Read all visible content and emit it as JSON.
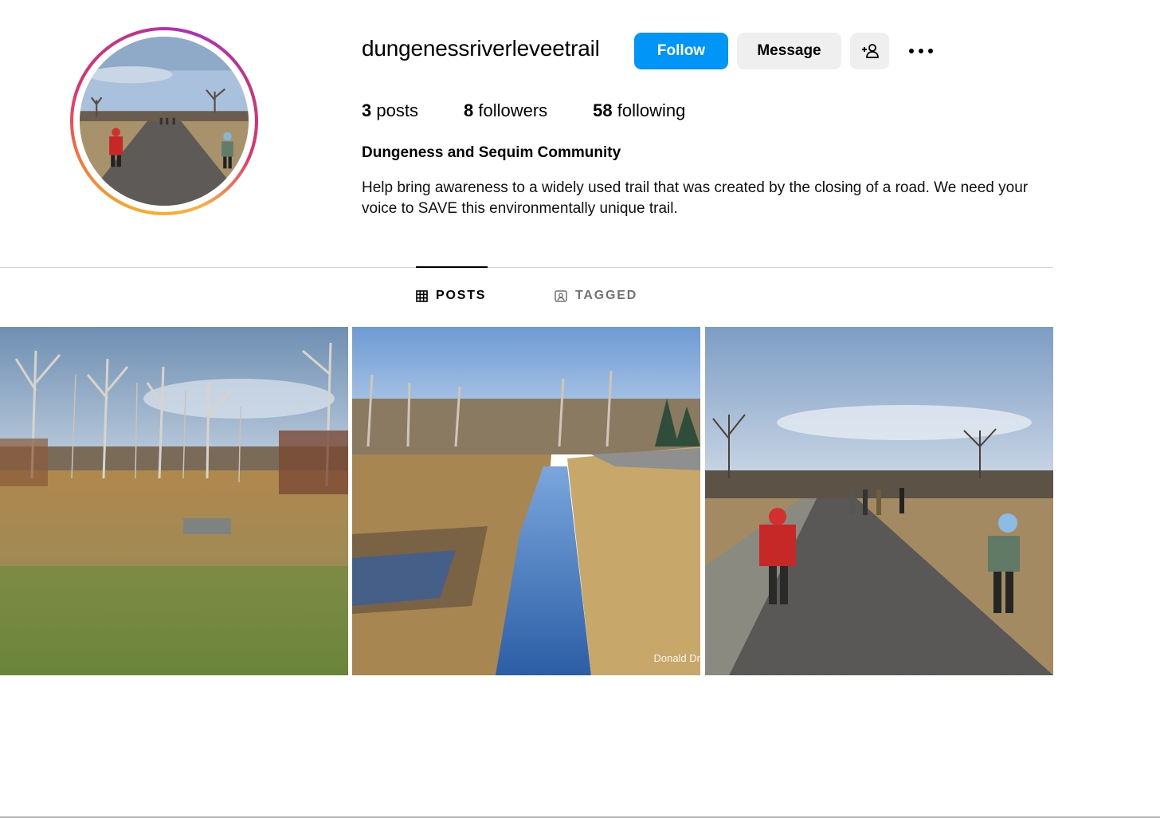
{
  "profile": {
    "username": "dungenessriverleveetrail",
    "full_name": "Dungeness and Sequim Community",
    "bio": "Help bring awareness to a widely used trail that was created by the closing of a road. We need your voice to SAVE this environmentally unique trail."
  },
  "actions": {
    "follow_label": "Follow",
    "message_label": "Message",
    "add_user_icon": "person-plus-icon",
    "more_icon": "more-dots-icon"
  },
  "stats": [
    {
      "count": "3",
      "label": "posts"
    },
    {
      "count": "8",
      "label": "followers"
    },
    {
      "count": "58",
      "label": "following"
    }
  ],
  "tabs": [
    {
      "label": "POSTS",
      "icon": "grid-icon",
      "active": true
    },
    {
      "label": "TAGGED",
      "icon": "tagged-icon",
      "active": false
    }
  ],
  "posts": [
    {
      "scene": "marsh-grassland"
    },
    {
      "scene": "river-channel-levee",
      "watermark": "Donald Dr"
    },
    {
      "scene": "trail-children-walking"
    }
  ],
  "colors": {
    "accent": "#0095f6",
    "button_gray": "#efefef",
    "muted_text": "#737373"
  }
}
